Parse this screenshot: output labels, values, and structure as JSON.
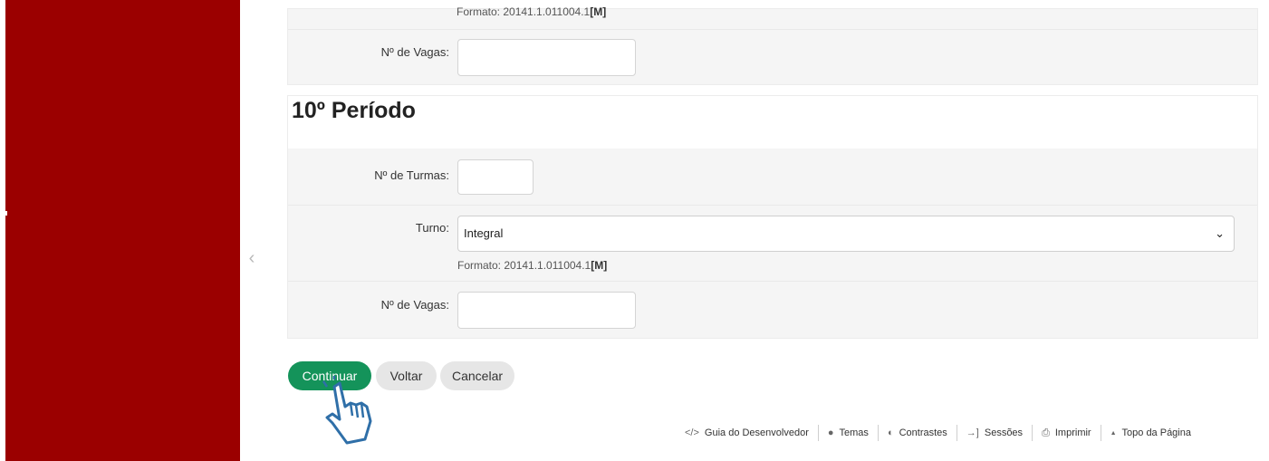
{
  "top_section": {
    "format_hint_prefix": "Formato: 20141.1.011004.1",
    "format_hint_bold": "[M]",
    "vagas_label": "Nº de Vagas:"
  },
  "period_section": {
    "heading": "10º Período",
    "turmas_label": "Nº de Turmas:",
    "turno_label": "Turno:",
    "turno_value": "Integral",
    "format_hint_prefix": "Formato: 20141.1.011004.1",
    "format_hint_bold": "[M]",
    "vagas_label": "Nº de Vagas:"
  },
  "actions": {
    "continue_label": "Continuar",
    "back_label": "Voltar",
    "cancel_label": "Cancelar"
  },
  "footer": {
    "items": [
      {
        "icon": "code-icon",
        "glyph": "</>",
        "label": "Guia do Desenvolvedor"
      },
      {
        "icon": "palette-icon",
        "glyph": "●",
        "label": "Temas"
      },
      {
        "icon": "contrast-icon",
        "glyph": "◐",
        "label": "Contrastes"
      },
      {
        "icon": "sign-in-icon",
        "glyph": "→]",
        "label": "Sessões"
      },
      {
        "icon": "print-icon",
        "glyph": "⎙",
        "label": "Imprimir"
      },
      {
        "icon": "arrow-up-icon",
        "glyph": "▲",
        "label": "Topo da Página"
      }
    ]
  },
  "colors": {
    "sidebar": "#9b0000",
    "primary_button": "#14935a"
  }
}
